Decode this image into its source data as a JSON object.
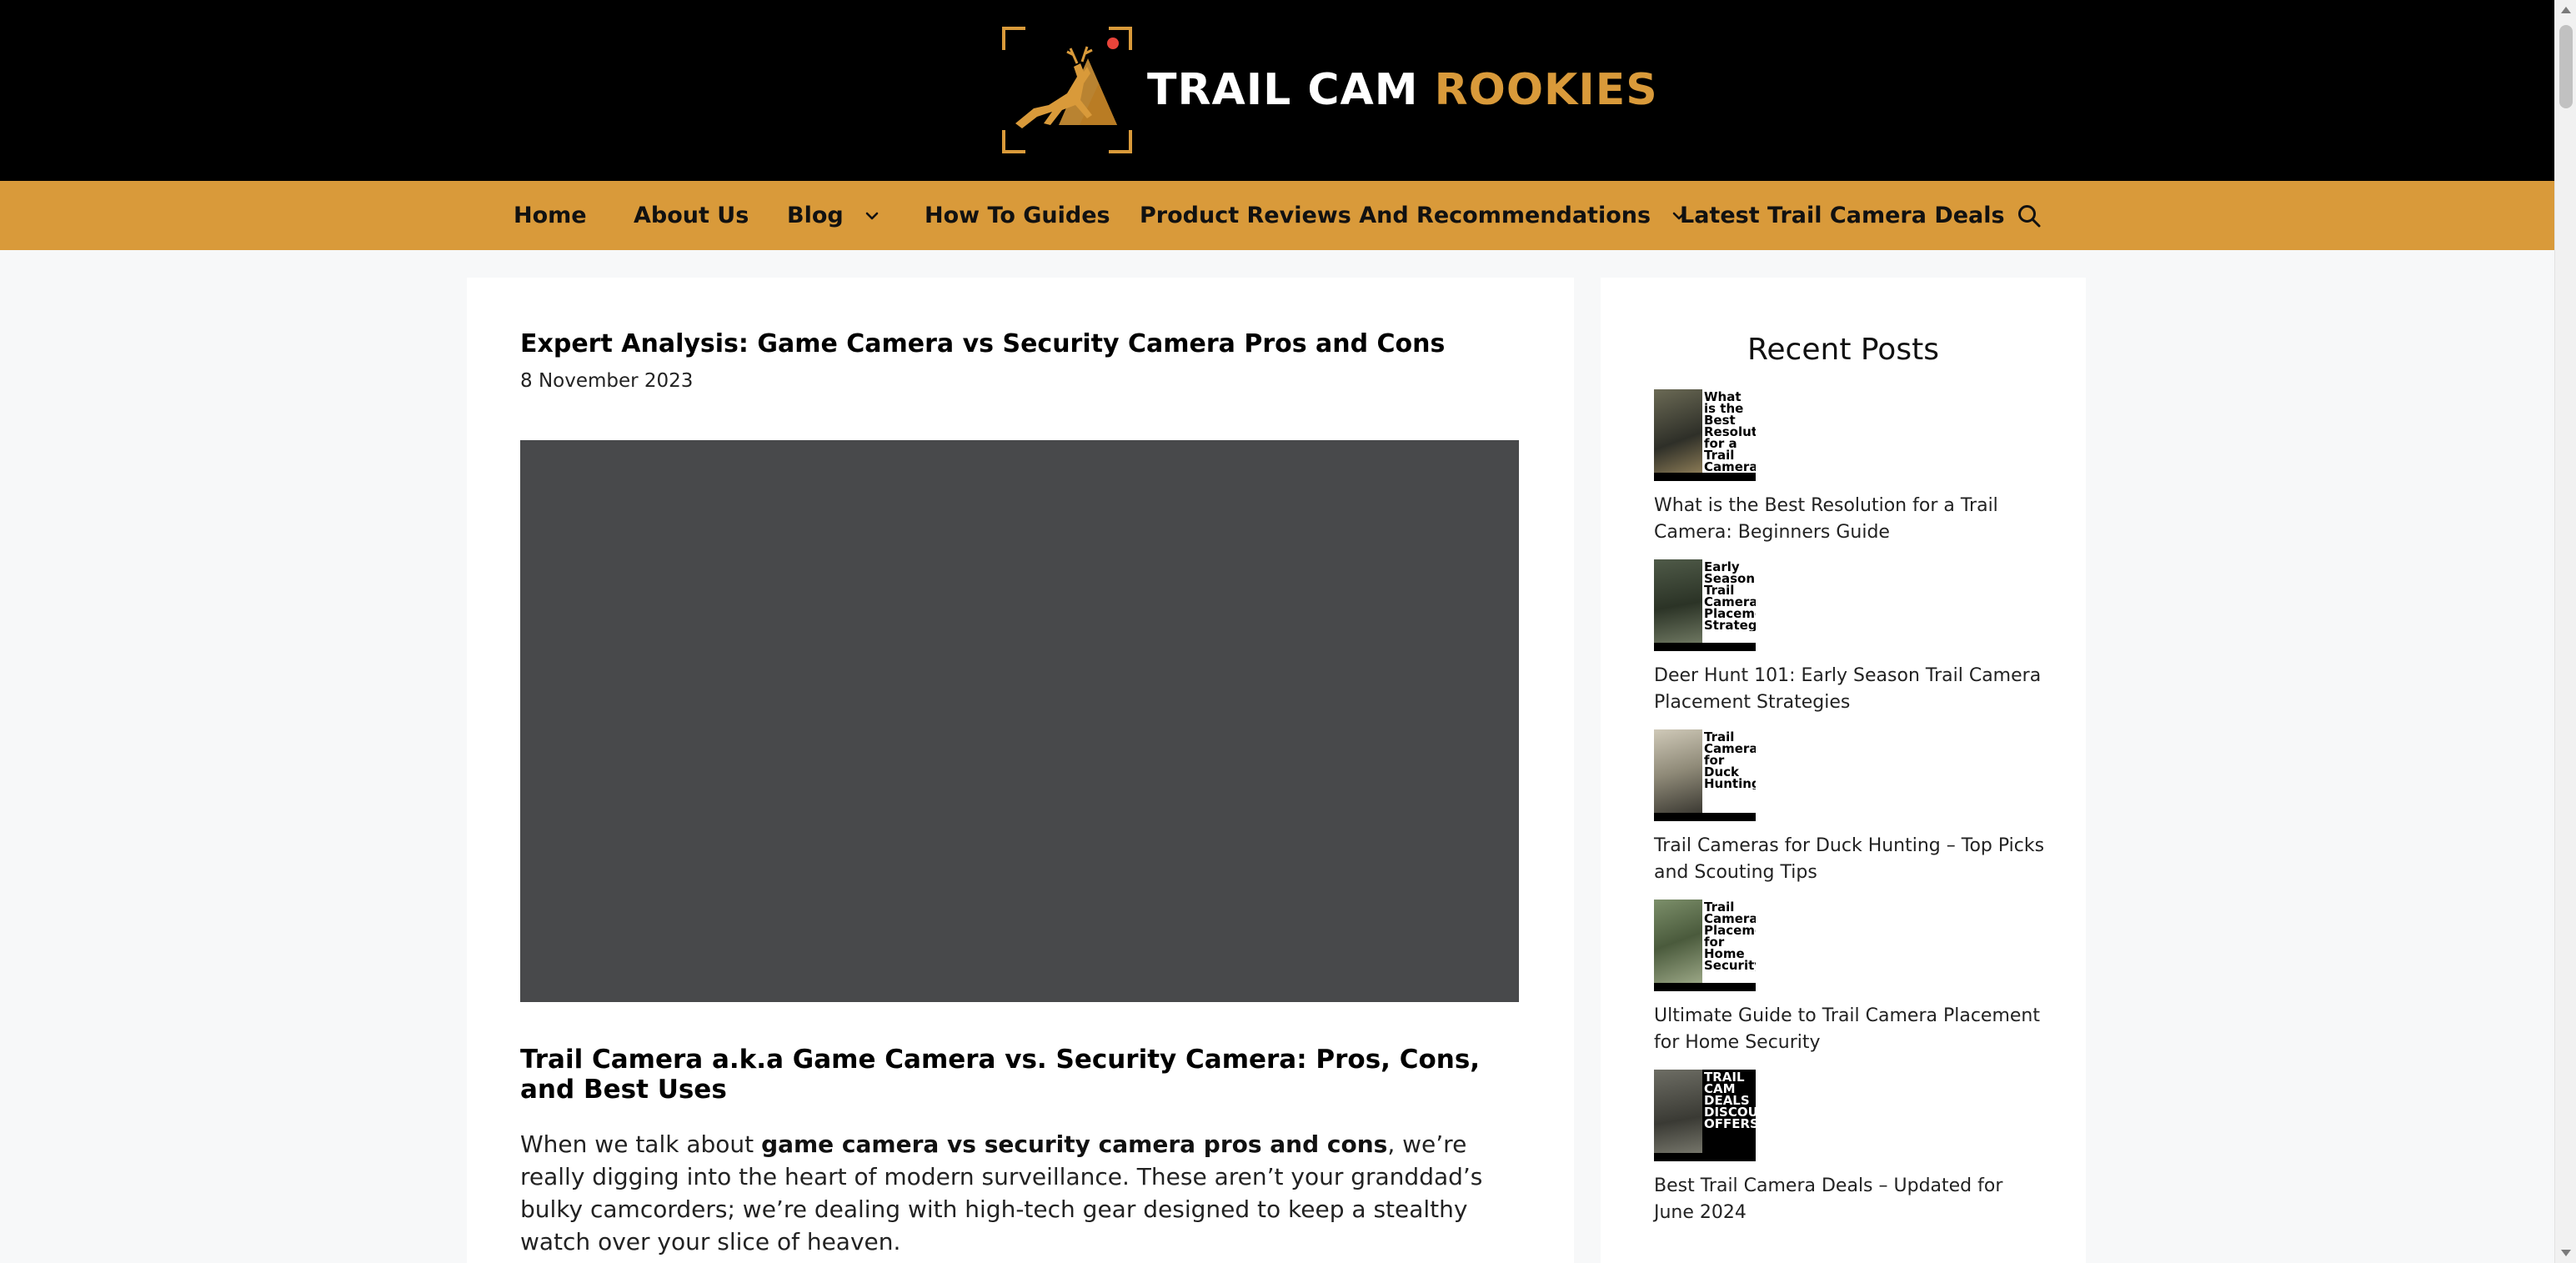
{
  "brand": {
    "logo_word1": "TRAIL CAM",
    "logo_word2": "ROOKIES",
    "accent_color": "#d99a3a",
    "header_bg": "#000000"
  },
  "nav": {
    "items": [
      {
        "label": "Home",
        "has_dropdown": false
      },
      {
        "label": "About Us",
        "has_dropdown": false
      },
      {
        "label": "Blog",
        "has_dropdown": true
      },
      {
        "label": "How To Guides",
        "has_dropdown": false
      },
      {
        "label": "Product Reviews And Recommendations",
        "has_dropdown": true
      },
      {
        "label": "Latest Trail Camera Deals",
        "has_dropdown": false
      }
    ],
    "search_icon": "search-icon"
  },
  "article": {
    "title": "Expert Analysis: Game Camera vs Security Camera Pros and Cons",
    "date": "8 November 2023",
    "section_heading": "Trail Camera a.k.a Game Camera vs. Security Camera: Pros, Cons, and Best Uses",
    "para_before": "When we talk about ",
    "para_bold": "game camera vs security camera pros and cons",
    "para_after": ", we’re really digging into the heart of modern surveillance. These aren’t your granddad’s bulky camcorders; we’re dealing with high-tech gear designed to keep a stealthy watch over your slice of heaven."
  },
  "sidebar": {
    "title": "Recent Posts",
    "posts": [
      {
        "title": "What is the Best Resolution for a Trail Camera: Beginners Guide",
        "thumb_text": "What is the Best Resolution for a Trail Camera"
      },
      {
        "title": "Deer Hunt 101: Early Season Trail Camera Placement Strategies",
        "thumb_text": "Early Season Trail Camera Placement Strategies"
      },
      {
        "title": "Trail Cameras for Duck Hunting – Top Picks and Scouting Tips",
        "thumb_text": "Trail Cameras for Duck Hunting"
      },
      {
        "title": "Ultimate Guide to Trail Camera Placement for Home Security",
        "thumb_text": "Trail Camera Placement for Home Security"
      },
      {
        "title": "Best Trail Camera Deals – Updated for June 2024",
        "thumb_text": "TRAIL CAM DEALS DISCOUNT OFFERS"
      }
    ]
  }
}
